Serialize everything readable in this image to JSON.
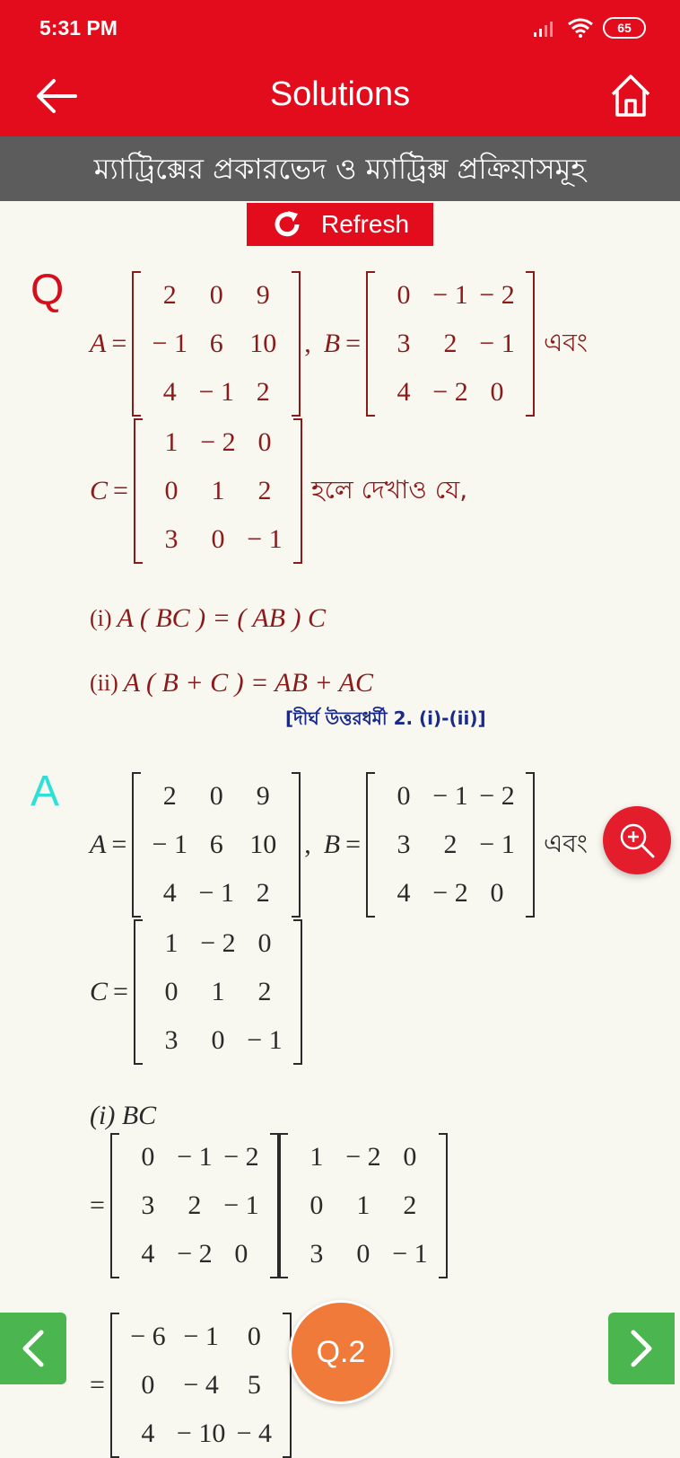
{
  "status_bar": {
    "time": "5:31 PM",
    "battery": "65",
    "icons": [
      "signal-icon",
      "wifi-icon",
      "battery-icon"
    ]
  },
  "app_bar": {
    "title": "Solutions",
    "back_icon": "back-arrow-icon",
    "home_icon": "home-icon"
  },
  "chapter_title": "ম্যাট্রিক্সের প্রকারভেদ ও ম্যাট্রিক্স প্রক্রিয়াসমূহ",
  "refresh_label": "Refresh",
  "question": {
    "label": "Q",
    "A_name": "A",
    "B_name": "B",
    "C_name": "C",
    "A": [
      [
        "2",
        "0",
        "9"
      ],
      [
        "− 1",
        "6",
        "10"
      ],
      [
        "4",
        "− 1",
        "2"
      ]
    ],
    "B": [
      [
        "0",
        "− 1",
        "− 2"
      ],
      [
        "3",
        "2",
        "− 1"
      ],
      [
        "4",
        "− 2",
        "0"
      ]
    ],
    "C": [
      [
        "1",
        "− 2",
        "0"
      ],
      [
        "0",
        "1",
        "2"
      ],
      [
        "3",
        "0",
        "− 1"
      ]
    ],
    "and_word": "এবং",
    "show_that": "হলে দেখাও যে,",
    "part_i_label": "(i)",
    "part_i": "A ( BC ) = ( AB ) C",
    "part_ii_label": "(ii)",
    "part_ii": "A ( B + C ) = AB + AC",
    "reference": "[দীর্ঘ উত্তরধর্মী 2. (i)-(ii)]"
  },
  "answer": {
    "label": "A",
    "part_i_heading": "(i) BC",
    "step1_left": [
      [
        "0",
        "− 1",
        "− 2"
      ],
      [
        "3",
        "2",
        "− 1"
      ],
      [
        "4",
        "− 2",
        "0"
      ]
    ],
    "step1_right": [
      [
        "1",
        "− 2",
        "0"
      ],
      [
        "0",
        "1",
        "2"
      ],
      [
        "3",
        "0",
        "− 1"
      ]
    ],
    "step2": [
      [
        "− 6",
        "− 1",
        "0"
      ],
      [
        "0",
        "− 4",
        "5"
      ],
      [
        "4",
        "− 10",
        "− 4"
      ]
    ]
  },
  "controls": {
    "zoom_icon": "zoom-in-icon",
    "prev_icon": "chevron-left-icon",
    "next_icon": "chevron-right-icon",
    "question_number": "Q.2"
  },
  "colors": {
    "primary_red": "#e20c1c",
    "banner_gray": "#5c5c5c",
    "nav_green": "#4bb54f",
    "badge_orange": "#f07a3a",
    "answer_cyan": "#2fe0d8"
  }
}
